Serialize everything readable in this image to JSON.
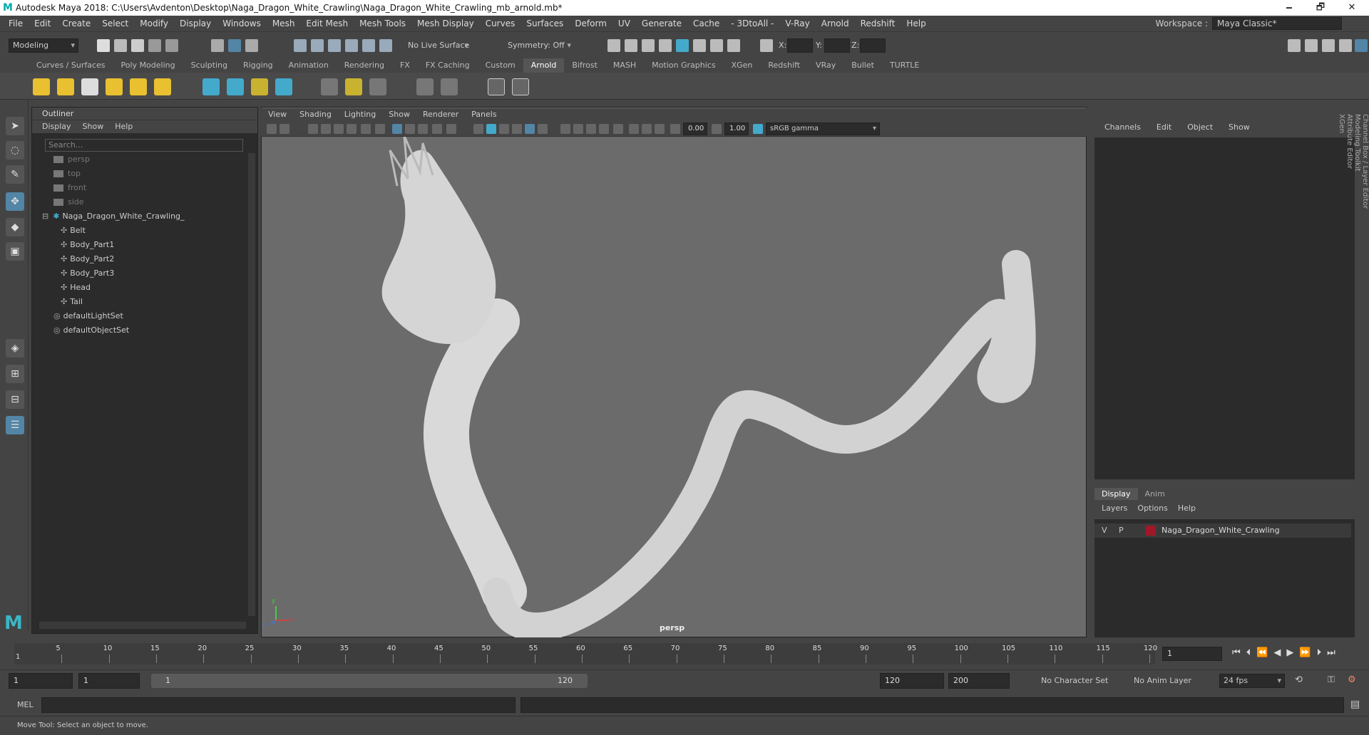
{
  "window": {
    "title": "Autodesk Maya 2018: C:\\Users\\Avdenton\\Desktop\\Naga_Dragon_White_Crawling\\Naga_Dragon_White_Crawling_mb_arnold.mb*",
    "logo": "M",
    "minimize": "🗕",
    "restore": "🗗",
    "close": "✕"
  },
  "menubar": {
    "items": [
      "File",
      "Edit",
      "Create",
      "Select",
      "Modify",
      "Display",
      "Windows",
      "Mesh",
      "Edit Mesh",
      "Mesh Tools",
      "Mesh Display",
      "Curves",
      "Surfaces",
      "Deform",
      "UV",
      "Generate",
      "Cache",
      "- 3DtoAll -",
      "V-Ray",
      "Arnold",
      "Redshift",
      "Help"
    ],
    "workspace_label": "Workspace :",
    "workspace_value": "Maya Classic*"
  },
  "statusline": {
    "mode": "Modeling",
    "live_surface": "No Live Surface",
    "symmetry": "Symmetry: Off",
    "x_label": "X:",
    "y_label": "Y:",
    "z_label": "Z:"
  },
  "shelf": {
    "tabs": [
      "Curves / Surfaces",
      "Poly Modeling",
      "Sculpting",
      "Rigging",
      "Animation",
      "Rendering",
      "FX",
      "FX Caching",
      "Custom",
      "Arnold",
      "Bifrost",
      "MASH",
      "Motion Graphics",
      "XGen",
      "Redshift",
      "VRay",
      "Bullet",
      "TURTLE"
    ],
    "active_tab": "Arnold"
  },
  "outliner": {
    "title": "Outliner",
    "menu": [
      "Display",
      "Show",
      "Help"
    ],
    "search_placeholder": "Search...",
    "cameras": [
      "persp",
      "top",
      "front",
      "side"
    ],
    "group": "Naga_Dragon_White_Crawling_",
    "children": [
      "Belt",
      "Body_Part1",
      "Body_Part2",
      "Body_Part3",
      "Head",
      "Tail"
    ],
    "sets": [
      "defaultLightSet",
      "defaultObjectSet"
    ]
  },
  "viewport": {
    "menu": [
      "View",
      "Shading",
      "Lighting",
      "Show",
      "Renderer",
      "Panels"
    ],
    "exposure": "0.00",
    "gamma": "1.00",
    "color_space": "sRGB gamma",
    "camera_label": "persp",
    "axis_x": "x",
    "axis_y": "y",
    "axis_z": "z"
  },
  "channelbox": {
    "menu": [
      "Channels",
      "Edit",
      "Object",
      "Show"
    ],
    "side_tabs": [
      "Channel Box / Layer Editor",
      "Modeling Toolkit",
      "Attribute Editor",
      "XGen"
    ]
  },
  "layers": {
    "tabs": [
      "Display",
      "Anim"
    ],
    "menu": [
      "Layers",
      "Options",
      "Help"
    ],
    "row": {
      "v": "V",
      "p": "P",
      "name": "Naga_Dragon_White_Crawling",
      "color": "#a01828"
    }
  },
  "timeline": {
    "ticks": [
      "5",
      "10",
      "15",
      "20",
      "25",
      "30",
      "35",
      "40",
      "45",
      "50",
      "55",
      "60",
      "65",
      "70",
      "75",
      "80",
      "85",
      "90",
      "95",
      "100",
      "105",
      "110",
      "115",
      "120"
    ],
    "first": "1",
    "current_frame": "1"
  },
  "range": {
    "start": "1",
    "playback_start": "1",
    "slider_start": "1",
    "slider_end": "120",
    "playback_end": "120",
    "end": "200",
    "character_set": "No Character Set",
    "anim_layer": "No Anim Layer",
    "fps": "24 fps"
  },
  "mel": {
    "label": "MEL"
  },
  "help": {
    "text": "Move Tool: Select an object to move."
  }
}
